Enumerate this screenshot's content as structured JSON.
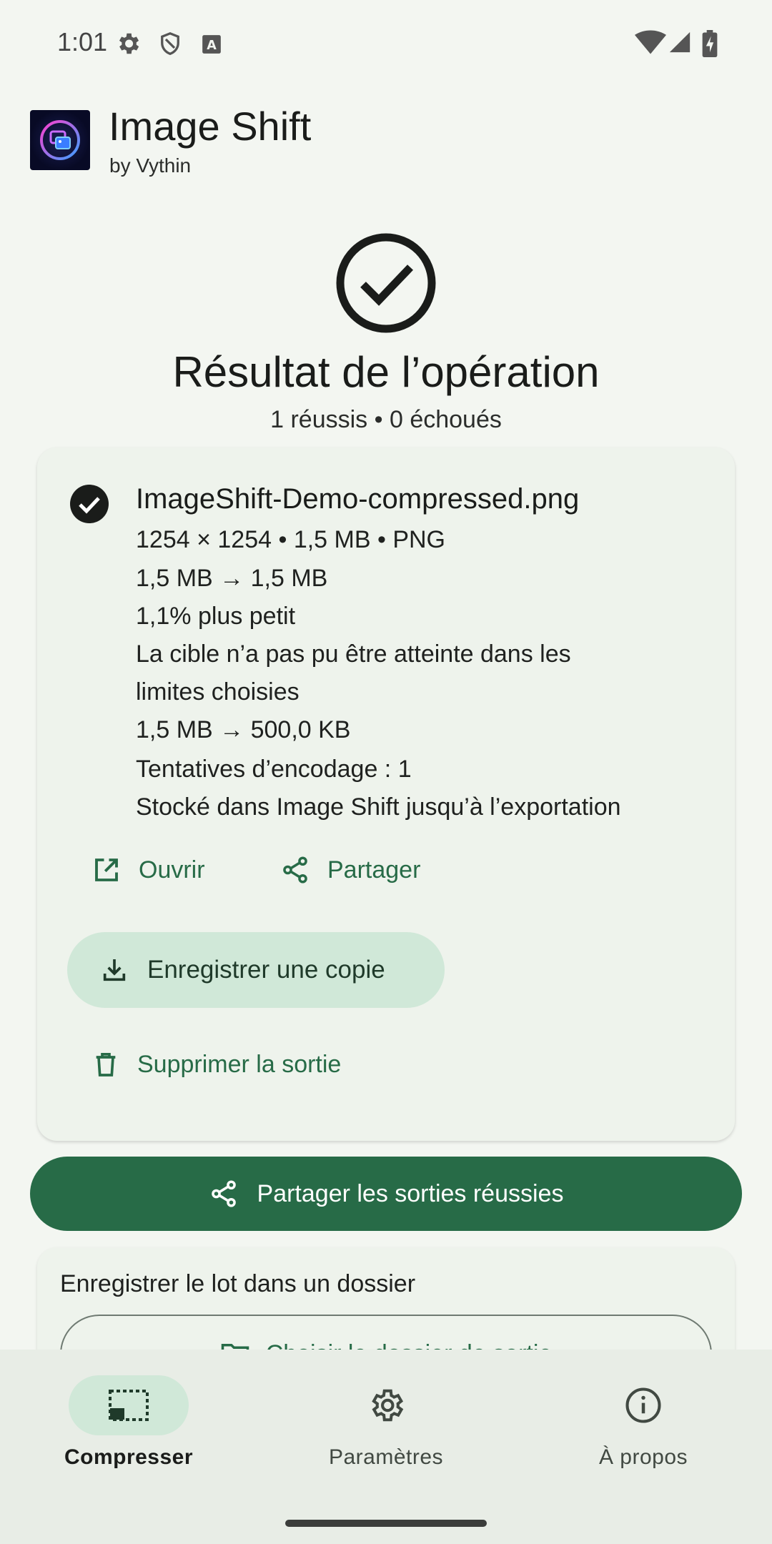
{
  "status_bar": {
    "time": "1:01",
    "icons": [
      "settings-gear-icon",
      "shield-icon",
      "font-a-icon",
      "wifi-icon",
      "cell-signal-icon",
      "battery-charging-icon"
    ]
  },
  "header": {
    "title": "Image Shift",
    "subtitle": "by Vythin"
  },
  "result": {
    "title": "Résultat de l’opération",
    "summary": "1 réussis • 0 échoués"
  },
  "file_card": {
    "name": "ImageShift-Demo-compressed.png",
    "lines": [
      "1254 × 1254 • 1,5 MB • PNG",
      "1,5 MB → 1,5 MB",
      "1,1% plus petit",
      "La cible n’a pas pu être atteinte dans les",
      "limites choisies",
      "1,5 MB → 500,0 KB",
      "Tentatives d’encodage : 1",
      "Stocké dans Image Shift jusqu’à l’exportation"
    ],
    "open_label": "Ouvrir",
    "share_label": "Partager",
    "save_copy_label": "Enregistrer une copie",
    "delete_label": "Supprimer la sortie"
  },
  "share_all_label": "Partager les sorties réussies",
  "batch_card": {
    "title": "Enregistrer le lot dans un dossier",
    "choose_folder_label": "Choisir le dossier de sortie"
  },
  "bottom_nav": {
    "items": [
      {
        "label": "Compresser",
        "icon": "compress-frame-icon",
        "active": true
      },
      {
        "label": "Paramètres",
        "icon": "settings-gear-icon",
        "active": false
      },
      {
        "label": "À propos",
        "icon": "info-icon",
        "active": false
      }
    ]
  },
  "colors": {
    "accent": "#276B47",
    "accent_container": "#D0E8D8",
    "background": "#F3F6F1",
    "card": "#EEF3EC"
  }
}
